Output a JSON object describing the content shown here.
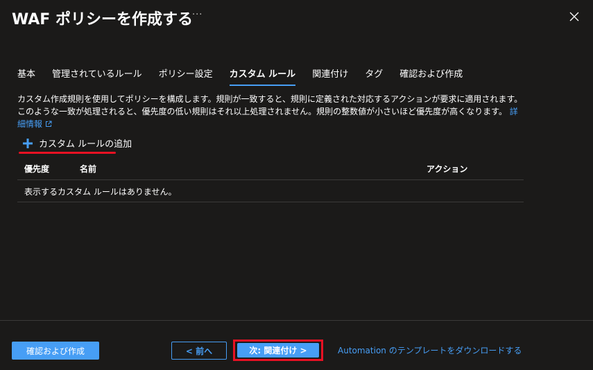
{
  "header": {
    "title": "WAF ポリシーを作成する",
    "more": "···"
  },
  "tabs": [
    {
      "label": "基本",
      "active": false
    },
    {
      "label": "管理されているルール",
      "active": false
    },
    {
      "label": "ポリシー設定",
      "active": false
    },
    {
      "label": "カスタム ルール",
      "active": true
    },
    {
      "label": "関連付け",
      "active": false
    },
    {
      "label": "タグ",
      "active": false
    },
    {
      "label": "確認および作成",
      "active": false
    }
  ],
  "description": {
    "text": "カスタム作成規則を使用してポリシーを構成します。規則が一致すると、規則に定義された対応するアクションが要求に適用されます。このような一致が処理されると、優先度の低い規則はそれ以上処理されません。規則の整数値が小さいほど優先度が高くなります。",
    "link": "詳細情報"
  },
  "add_rule": {
    "label": "カスタム ルールの追加"
  },
  "table": {
    "columns": [
      "優先度",
      "名前",
      "アクション"
    ],
    "empty_message": "表示するカスタム ルールはありません。"
  },
  "footer": {
    "review_create": "確認および作成",
    "previous": "< 前へ",
    "next": "次: 関連付け >",
    "automation_link": "Automation のテンプレートをダウンロードする"
  },
  "colors": {
    "background": "#1b1a19",
    "accent": "#479ef5",
    "highlight": "#e81123",
    "divider": "#3b3a39"
  }
}
